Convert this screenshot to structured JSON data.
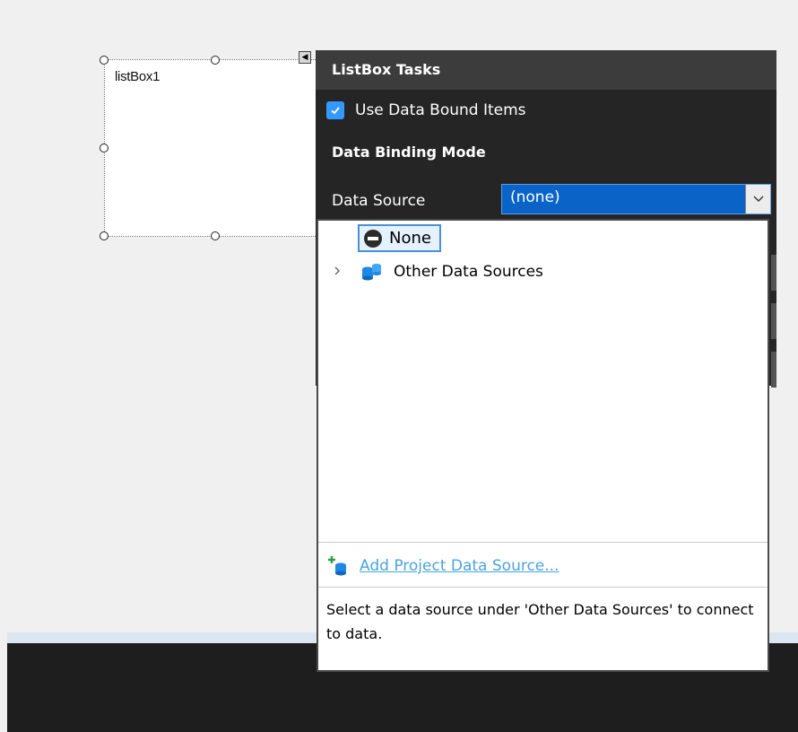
{
  "control": {
    "name": "listBox1"
  },
  "tasks": {
    "title": "ListBox Tasks",
    "use_data_bound": {
      "label": "Use Data Bound Items",
      "checked": true
    },
    "section_title": "Data Binding Mode",
    "data_source": {
      "label": "Data Source",
      "value": "(none)"
    }
  },
  "dropdown": {
    "none_label": "None",
    "other_sources_label": "Other Data Sources",
    "add_link_label": "Add Project Data Source...",
    "help_text": "Select a data source under 'Other Data Sources' to connect to data."
  },
  "colors": {
    "accent": "#0a64c8",
    "panel_bg": "#252526",
    "panel_header": "#3c3c3c",
    "link": "#4aa3e0"
  },
  "icons": {
    "none": "no-entry-icon",
    "other_sources": "database-icon",
    "add_source": "add-database-icon",
    "expander": "chevron-right-icon",
    "combo": "chevron-down-icon",
    "checkbox": "checkmark-icon",
    "smart_tag": "smart-tag-arrow-icon"
  }
}
